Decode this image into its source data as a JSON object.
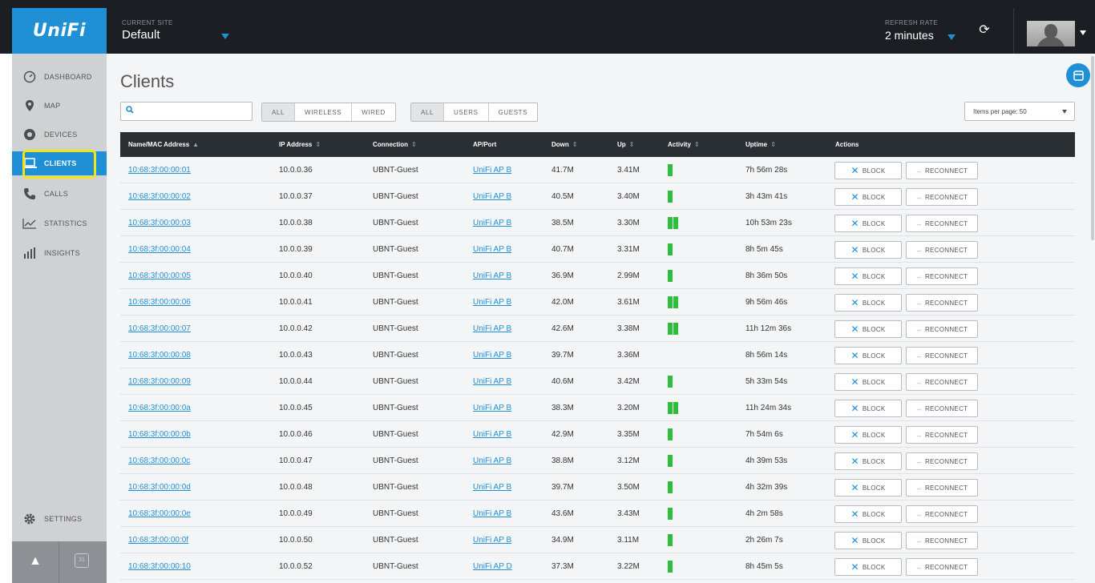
{
  "brand": {
    "logo": "UniFi"
  },
  "header": {
    "site_label": "CURRENT SITE",
    "site_value": "Default",
    "refresh_label": "REFRESH RATE",
    "refresh_value": "2 minutes",
    "refresh_icon": "refresh-icon",
    "avatar_icon": "user-avatar"
  },
  "sidebar": {
    "items": [
      {
        "label": "DASHBOARD",
        "icon": "dashboard-icon",
        "active": false
      },
      {
        "label": "MAP",
        "icon": "map-pin-icon",
        "active": false
      },
      {
        "label": "DEVICES",
        "icon": "devices-icon",
        "active": false
      },
      {
        "label": "CLIENTS",
        "icon": "laptop-icon",
        "active": true
      },
      {
        "label": "CALLS",
        "icon": "phone-icon",
        "active": false
      },
      {
        "label": "STATISTICS",
        "icon": "chart-line-icon",
        "active": false
      },
      {
        "label": "INSIGHTS",
        "icon": "bar-chart-icon",
        "active": false
      }
    ],
    "settings_label": "SETTINGS",
    "footer": {
      "calendar_text": "31"
    }
  },
  "page": {
    "title": "Clients",
    "search_placeholder": "",
    "filter_type": [
      "ALL",
      "WIRELESS",
      "WIRED"
    ],
    "filter_user": [
      "ALL",
      "USERS",
      "GUESTS"
    ],
    "items_per_page": "Items per page: 50"
  },
  "table": {
    "columns": [
      {
        "label": "Name/MAC Address",
        "sort": "▲"
      },
      {
        "label": "IP Address",
        "sort": "⇕"
      },
      {
        "label": "Connection",
        "sort": "⇕"
      },
      {
        "label": "AP/Port",
        "sort": ""
      },
      {
        "label": "Down",
        "sort": "⇕"
      },
      {
        "label": "Up",
        "sort": "⇕"
      },
      {
        "label": "Activity",
        "sort": "⇕"
      },
      {
        "label": "Uptime",
        "sort": "⇕"
      },
      {
        "label": "Actions",
        "sort": ""
      }
    ],
    "block_label": "BLOCK",
    "reconnect_label": "RECONNECT",
    "rows": [
      {
        "mac": "10:68:3f:00:00:01",
        "ip": "10.0.0.36",
        "conn": "UBNT-Guest",
        "ap": "UniFi AP B",
        "down": "41.7M",
        "up": "3.41M",
        "activity": 1,
        "uptime": "7h 56m 28s"
      },
      {
        "mac": "10:68:3f:00:00:02",
        "ip": "10.0.0.37",
        "conn": "UBNT-Guest",
        "ap": "UniFi AP B",
        "down": "40.5M",
        "up": "3.40M",
        "activity": 1,
        "uptime": "3h 43m 41s"
      },
      {
        "mac": "10:68:3f:00:00:03",
        "ip": "10.0.0.38",
        "conn": "UBNT-Guest",
        "ap": "UniFi AP B",
        "down": "38.5M",
        "up": "3.30M",
        "activity": 2,
        "uptime": "10h 53m 23s"
      },
      {
        "mac": "10:68:3f:00:00:04",
        "ip": "10.0.0.39",
        "conn": "UBNT-Guest",
        "ap": "UniFi AP B",
        "down": "40.7M",
        "up": "3.31M",
        "activity": 1,
        "uptime": "8h 5m 45s"
      },
      {
        "mac": "10:68:3f:00:00:05",
        "ip": "10.0.0.40",
        "conn": "UBNT-Guest",
        "ap": "UniFi AP B",
        "down": "36.9M",
        "up": "2.99M",
        "activity": 1,
        "uptime": "8h 36m 50s"
      },
      {
        "mac": "10:68:3f:00:00:06",
        "ip": "10.0.0.41",
        "conn": "UBNT-Guest",
        "ap": "UniFi AP B",
        "down": "42.0M",
        "up": "3.61M",
        "activity": 2,
        "uptime": "9h 56m 46s"
      },
      {
        "mac": "10:68:3f:00:00:07",
        "ip": "10.0.0.42",
        "conn": "UBNT-Guest",
        "ap": "UniFi AP B",
        "down": "42.6M",
        "up": "3.38M",
        "activity": 2,
        "uptime": "11h 12m 36s"
      },
      {
        "mac": "10:68:3f:00:00:08",
        "ip": "10.0.0.43",
        "conn": "UBNT-Guest",
        "ap": "UniFi AP B",
        "down": "39.7M",
        "up": "3.36M",
        "activity": 0,
        "uptime": "8h 56m 14s"
      },
      {
        "mac": "10:68:3f:00:00:09",
        "ip": "10.0.0.44",
        "conn": "UBNT-Guest",
        "ap": "UniFi AP B",
        "down": "40.6M",
        "up": "3.42M",
        "activity": 1,
        "uptime": "5h 33m 54s"
      },
      {
        "mac": "10:68:3f:00:00:0a",
        "ip": "10.0.0.45",
        "conn": "UBNT-Guest",
        "ap": "UniFi AP B",
        "down": "38.3M",
        "up": "3.20M",
        "activity": 2,
        "uptime": "11h 24m 34s"
      },
      {
        "mac": "10:68:3f:00:00:0b",
        "ip": "10.0.0.46",
        "conn": "UBNT-Guest",
        "ap": "UniFi AP B",
        "down": "42.9M",
        "up": "3.35M",
        "activity": 1,
        "uptime": "7h 54m 6s"
      },
      {
        "mac": "10:68:3f:00:00:0c",
        "ip": "10.0.0.47",
        "conn": "UBNT-Guest",
        "ap": "UniFi AP B",
        "down": "38.8M",
        "up": "3.12M",
        "activity": 1,
        "uptime": "4h 39m 53s"
      },
      {
        "mac": "10:68:3f:00:00:0d",
        "ip": "10.0.0.48",
        "conn": "UBNT-Guest",
        "ap": "UniFi AP B",
        "down": "39.7M",
        "up": "3.50M",
        "activity": 1,
        "uptime": "4h 32m 39s"
      },
      {
        "mac": "10:68:3f:00:00:0e",
        "ip": "10.0.0.49",
        "conn": "UBNT-Guest",
        "ap": "UniFi AP B",
        "down": "43.6M",
        "up": "3.43M",
        "activity": 1,
        "uptime": "4h 2m 58s"
      },
      {
        "mac": "10:68:3f:00:00:0f",
        "ip": "10.0.0.50",
        "conn": "UBNT-Guest",
        "ap": "UniFi AP B",
        "down": "34.9M",
        "up": "3.11M",
        "activity": 1,
        "uptime": "2h 26m 7s"
      },
      {
        "mac": "10:68:3f:00:00:10",
        "ip": "10.0.0.52",
        "conn": "UBNT-Guest",
        "ap": "UniFi AP D",
        "down": "37.3M",
        "up": "3.22M",
        "activity": 1,
        "uptime": "8h 45m 5s"
      }
    ]
  },
  "colors": {
    "accent": "#1f8fd6",
    "topbar": "#1b1f24",
    "sidebar": "#cfd1d3",
    "activity": "#2ebd3d",
    "highlight": "#f6e315"
  }
}
